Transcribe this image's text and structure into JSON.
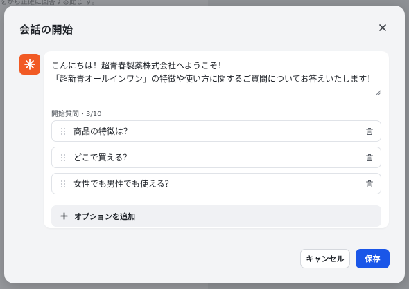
{
  "background": {
    "top_text": "をから正確に回答する此じ す。"
  },
  "dialog": {
    "title": "会話の開始",
    "welcome_line1": "こんにちは！超青春製薬株式会社へようこそ！",
    "welcome_line2": "「超新青オールインワン」の特徴や使い方に関するご質問についてお答えいたします！",
    "section_label": "開始質問・3/10",
    "questions": [
      "商品の特徴は？",
      "どこで買える？",
      "女性でも男性でも使える？"
    ],
    "add_option": "オプションを追加",
    "cancel": "キャンセル",
    "save": "保存"
  },
  "colors": {
    "accent": "#1a56e8",
    "avatar": "#f15a24"
  },
  "icons": [
    "close-icon",
    "asterisk-icon",
    "drag-handle-icon",
    "trash-icon",
    "plus-icon"
  ]
}
